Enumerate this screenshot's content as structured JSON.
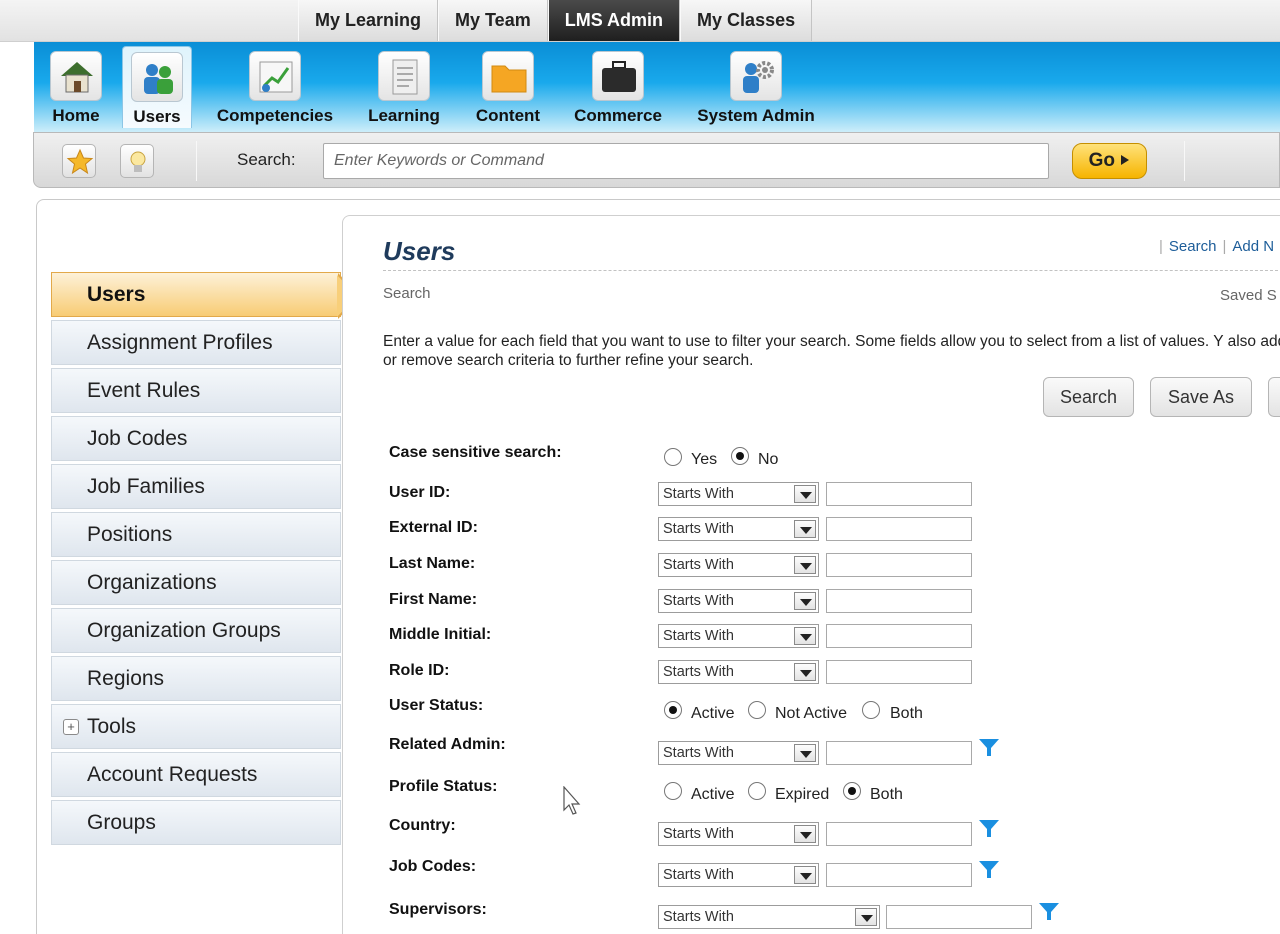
{
  "top_tabs": [
    {
      "label": "My Learning",
      "active": false
    },
    {
      "label": "My Team",
      "active": false
    },
    {
      "label": "LMS Admin",
      "active": true
    },
    {
      "label": "My Classes",
      "active": false
    }
  ],
  "main_nav": [
    {
      "label": "Home",
      "icon": "home-icon"
    },
    {
      "label": "Users",
      "icon": "users-icon",
      "active": true
    },
    {
      "label": "Competencies",
      "icon": "competencies-icon"
    },
    {
      "label": "Learning",
      "icon": "learning-icon"
    },
    {
      "label": "Content",
      "icon": "folder-icon"
    },
    {
      "label": "Commerce",
      "icon": "briefcase-icon"
    },
    {
      "label": "System Admin",
      "icon": "system-admin-icon"
    }
  ],
  "toolbar": {
    "search_label": "Search:",
    "search_placeholder": "Enter Keywords or Command",
    "go_label": "Go"
  },
  "sidebar": {
    "items": [
      {
        "label": "Users",
        "active": true
      },
      {
        "label": "Assignment Profiles"
      },
      {
        "label": "Event Rules"
      },
      {
        "label": "Job Codes"
      },
      {
        "label": "Job Families"
      },
      {
        "label": "Positions"
      },
      {
        "label": "Organizations"
      },
      {
        "label": "Organization Groups"
      },
      {
        "label": "Regions"
      },
      {
        "label": "Tools",
        "expandable": true
      },
      {
        "label": "Account Requests"
      },
      {
        "label": "Groups"
      }
    ]
  },
  "content": {
    "title": "Users",
    "links": {
      "search": "Search",
      "add_new": "Add N"
    },
    "section": "Search",
    "saved": "Saved S",
    "instructions": "Enter a value for each field that you want to use to filter your search. Some fields allow you to select from a list of values. Y also add or remove search criteria to further refine your search.",
    "buttons": {
      "search": "Search",
      "save_as": "Save As"
    }
  },
  "form": {
    "case_sensitive": {
      "label": "Case sensitive search:",
      "options": [
        "Yes",
        "No"
      ],
      "selected": "No"
    },
    "user_id": {
      "label": "User ID:",
      "operator": "Starts With"
    },
    "external_id": {
      "label": "External ID:",
      "operator": "Starts With"
    },
    "last_name": {
      "label": "Last Name:",
      "operator": "Starts With"
    },
    "first_name": {
      "label": "First Name:",
      "operator": "Starts With"
    },
    "middle_initial": {
      "label": "Middle Initial:",
      "operator": "Starts With"
    },
    "role_id": {
      "label": "Role ID:",
      "operator": "Starts With"
    },
    "user_status": {
      "label": "User Status:",
      "options": [
        "Active",
        "Not Active",
        "Both"
      ],
      "selected": "Active"
    },
    "related_admin": {
      "label": "Related Admin:",
      "operator": "Starts With"
    },
    "profile_status": {
      "label": "Profile Status:",
      "options": [
        "Active",
        "Expired",
        "Both"
      ],
      "selected": "Both"
    },
    "country": {
      "label": "Country:",
      "operator": "Starts With"
    },
    "job_codes": {
      "label": "Job Codes:",
      "operator": "Starts With"
    },
    "supervisors": {
      "label": "Supervisors:",
      "operator": "Starts With"
    }
  },
  "colors": {
    "accent_blue": "#19a9ec",
    "active_orange": "#f8cc74",
    "go_yellow": "#f6b400",
    "filter_blue": "#1a8fe0"
  }
}
